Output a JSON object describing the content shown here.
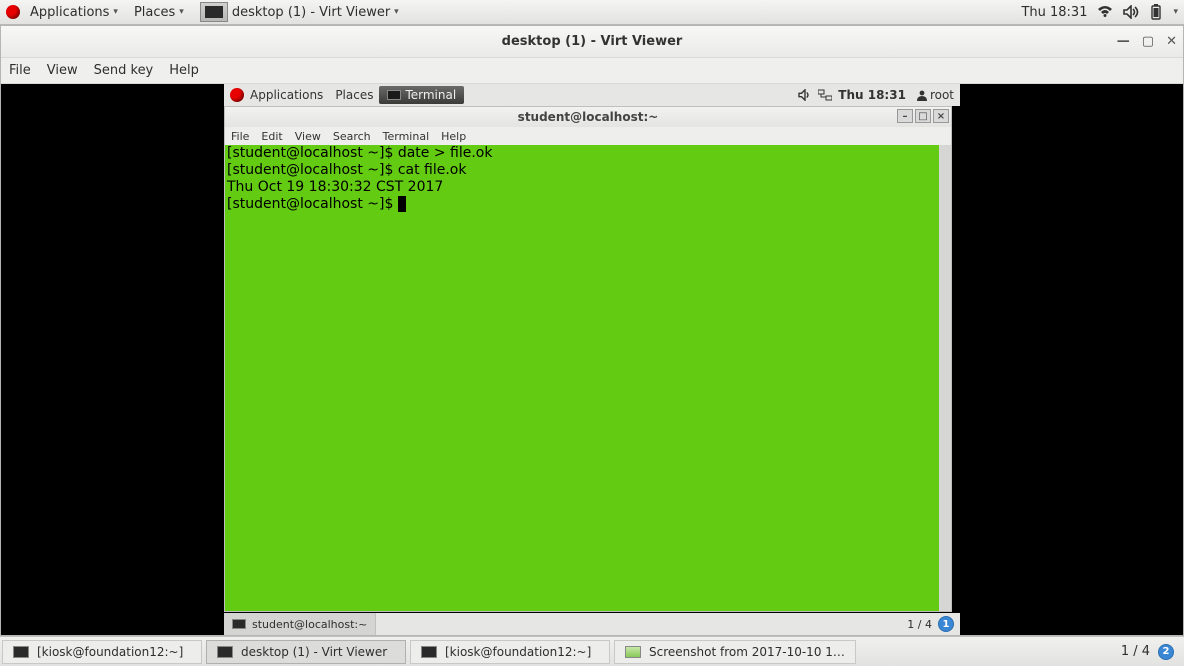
{
  "outer_panel": {
    "applications": "Applications",
    "places": "Places",
    "active_task": "desktop (1) - Virt Viewer",
    "time": "Thu 18:31"
  },
  "virt_viewer": {
    "title": "desktop (1) - Virt Viewer",
    "menu": {
      "file": "File",
      "view": "View",
      "sendkey": "Send key",
      "help": "Help"
    }
  },
  "vm_panel": {
    "applications": "Applications",
    "places": "Places",
    "active_task": "Terminal",
    "time": "Thu 18:31",
    "user": "root"
  },
  "terminal": {
    "title": "student@localhost:~",
    "menu": {
      "file": "File",
      "edit": "Edit",
      "view": "View",
      "search": "Search",
      "terminal": "Terminal",
      "help": "Help"
    },
    "lines": [
      "[student@localhost ~]$ date > file.ok",
      "[student@localhost ~]$ cat file.ok",
      "Thu Oct 19 18:30:32 CST 2017",
      "[student@localhost ~]$ "
    ]
  },
  "vm_bottom": {
    "task": "student@localhost:~",
    "pager_label": "1 / 4",
    "badge": "1"
  },
  "outer_bottom": {
    "tasks": [
      "[kiosk@foundation12:~]",
      "desktop (1) - Virt Viewer",
      "[kiosk@foundation12:~]",
      "Screenshot from 2017-10-10 1…"
    ],
    "pager_label": "1 / 4",
    "badge": "2"
  }
}
